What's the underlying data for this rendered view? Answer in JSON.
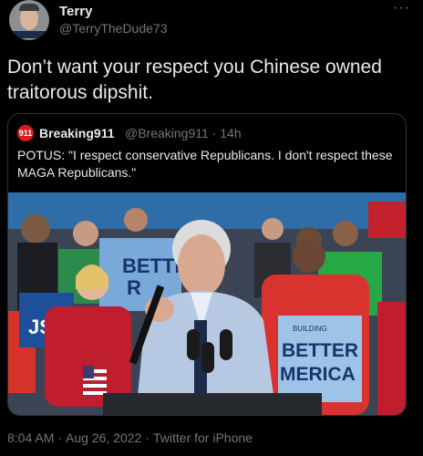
{
  "tweet": {
    "author_name": "Terry",
    "author_handle": "@TerryTheDude73",
    "more_icon": "···",
    "text": "Don’t want your respect you Chinese owned traitorous dipshit."
  },
  "quoted": {
    "logo_text": "911",
    "author_name": "Breaking911",
    "author_handle": "@Breaking911",
    "separator": "·",
    "time": "14h",
    "text": "POTUS: \"I respect conservative Republicans. I don't respect these MAGA Republicans.\"",
    "media": {
      "sign_left": "BETTE",
      "sign_left_2": "R",
      "sign_right_1": "BETTER",
      "sign_right_2": "MERICA",
      "sign_right_small": "BUILDING",
      "sign_far_left": "JS"
    }
  },
  "meta": {
    "time": "8:04 AM",
    "date": "Aug 26, 2022",
    "separator": "·",
    "source": "Twitter for iPhone"
  },
  "colors": {
    "background": "#000000",
    "text_primary": "#e7e9ea",
    "text_secondary": "#71767b",
    "border": "#2f3336"
  }
}
